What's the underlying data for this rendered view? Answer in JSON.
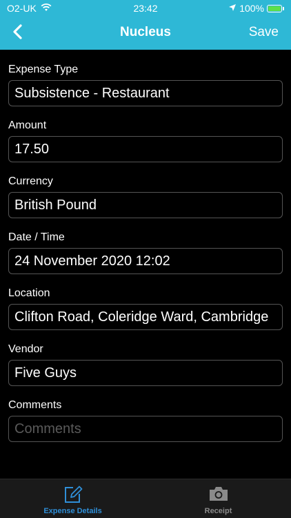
{
  "status_bar": {
    "carrier": "O2-UK",
    "time": "23:42",
    "battery": "100%"
  },
  "nav": {
    "title": "Nucleus",
    "save_label": "Save"
  },
  "fields": [
    {
      "label": "Expense Type",
      "value": "Subsistence - Restaurant"
    },
    {
      "label": "Amount",
      "value": "17.50"
    },
    {
      "label": "Currency",
      "value": "British Pound"
    },
    {
      "label": "Date / Time",
      "value": "24 November 2020 12:02"
    },
    {
      "label": "Location",
      "value": "Clifton Road, Coleridge Ward, Cambridge"
    },
    {
      "label": "Vendor",
      "value": "Five Guys"
    },
    {
      "label": "Comments",
      "value": "",
      "placeholder": "Comments"
    }
  ],
  "tabs": [
    {
      "label": "Expense Details",
      "icon": "edit-icon",
      "active": true
    },
    {
      "label": "Receipt",
      "icon": "camera-icon",
      "active": false
    }
  ],
  "colors": {
    "accent": "#2eb8d6",
    "active_tab": "#2f8fd8",
    "inactive_tab": "#8a8a8a",
    "battery": "#5ee04a"
  }
}
